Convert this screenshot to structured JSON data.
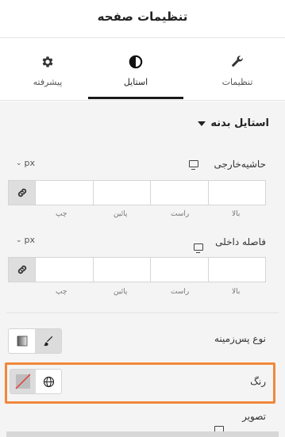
{
  "header": {
    "title": "تنظیمات صفحه"
  },
  "tabs": [
    {
      "label": "پیشرفته",
      "icon": "gear-icon"
    },
    {
      "label": "استایل",
      "icon": "contrast-icon",
      "active": true
    },
    {
      "label": "تنظیمات",
      "icon": "wrench-icon"
    }
  ],
  "section": {
    "title": "استایل بدنه"
  },
  "margin": {
    "label": "حاشیه‌خارجی",
    "unit": "px",
    "sides": [
      "بالا",
      "راست",
      "پائین",
      "چپ"
    ]
  },
  "padding": {
    "label": "فاصله داخلی",
    "unit": "px",
    "sides": [
      "بالا",
      "راست",
      "پائین",
      "چپ"
    ]
  },
  "background": {
    "label": "نوع پس‌زمینه"
  },
  "color": {
    "label": "رنگ"
  },
  "image": {
    "label": "تصویر"
  },
  "colors": {
    "highlight": "#f0883a",
    "panel": "#f4f4f4"
  }
}
